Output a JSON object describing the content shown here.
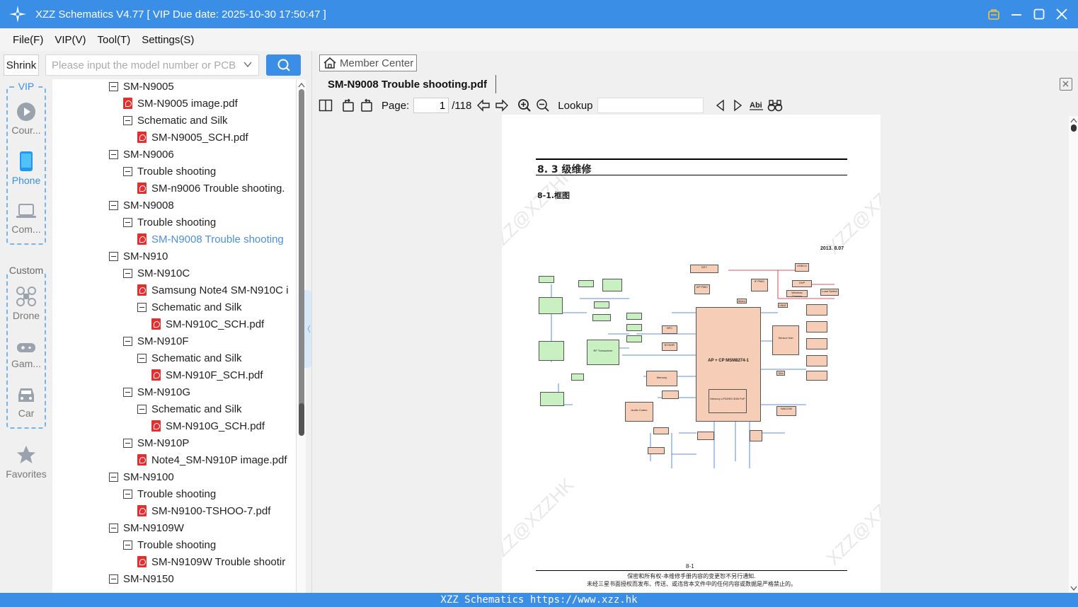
{
  "window": {
    "title": "XZZ Schematics V4.77 [ VIP Due date: 2025-10-30 17:50:47 ]"
  },
  "menu": {
    "items": [
      "File(F)",
      "VIP(V)",
      "Tool(T)",
      "Settings(S)"
    ]
  },
  "search": {
    "shrink_label": "Shrink",
    "placeholder": "Please input the model number or PCB"
  },
  "nav": {
    "vip_label": "VIP",
    "custom_label": "Custom",
    "items": [
      {
        "label": "Cour...",
        "icon": "play-icon"
      },
      {
        "label": "Phone",
        "icon": "phone-icon"
      },
      {
        "label": "Com...",
        "icon": "laptop-icon"
      },
      {
        "label": "Drone",
        "icon": "drone-icon"
      },
      {
        "label": "Gam...",
        "icon": "gamepad-icon"
      },
      {
        "label": "Car",
        "icon": "car-icon"
      },
      {
        "label": "Favorites",
        "icon": "star-icon"
      }
    ]
  },
  "tree": {
    "rows": [
      {
        "text": "SM-N9005",
        "type": "folder"
      },
      {
        "text": "SM-N9005 image.pdf",
        "type": "pdf"
      },
      {
        "text": "Schematic and Silk",
        "type": "folder"
      },
      {
        "text": "SM-N9005_SCH.pdf",
        "type": "pdf"
      },
      {
        "text": "SM-N9006",
        "type": "folder"
      },
      {
        "text": "Trouble shooting",
        "type": "folder"
      },
      {
        "text": "SM-n9006 Trouble shooting.",
        "type": "pdf"
      },
      {
        "text": "SM-N9008",
        "type": "folder"
      },
      {
        "text": "Trouble shooting",
        "type": "folder"
      },
      {
        "text": "SM-N9008 Trouble shooting",
        "type": "pdf"
      },
      {
        "text": "SM-N910",
        "type": "folder"
      },
      {
        "text": "SM-N910C",
        "type": "folder"
      },
      {
        "text": "Samsung Note4 SM-N910C i",
        "type": "pdf"
      },
      {
        "text": "Schematic and Silk",
        "type": "folder"
      },
      {
        "text": "SM-N910C_SCH.pdf",
        "type": "pdf"
      },
      {
        "text": "SM-N910F",
        "type": "folder"
      },
      {
        "text": "Schematic and Silk",
        "type": "folder"
      },
      {
        "text": "SM-N910F_SCH.pdf",
        "type": "pdf"
      },
      {
        "text": "SM-N910G",
        "type": "folder"
      },
      {
        "text": "Schematic and Silk",
        "type": "folder"
      },
      {
        "text": "SM-N910G_SCH.pdf",
        "type": "pdf"
      },
      {
        "text": "SM-N910P",
        "type": "folder"
      },
      {
        "text": "Note4_SM-N910P image.pdf",
        "type": "pdf"
      },
      {
        "text": "SM-N9100",
        "type": "folder"
      },
      {
        "text": "Trouble shooting",
        "type": "folder"
      },
      {
        "text": "SM-N9100-TSHOO-7.pdf",
        "type": "pdf"
      },
      {
        "text": "SM-N9109W",
        "type": "folder"
      },
      {
        "text": "Trouble shooting",
        "type": "folder"
      },
      {
        "text": "SM-N9109W Trouble shootir",
        "type": "pdf"
      },
      {
        "text": "SM-N9150",
        "type": "folder"
      }
    ],
    "selected_index": 9
  },
  "viewer": {
    "member_center": "Member Center",
    "tab_title": "SM-N9008 Trouble shooting.pdf",
    "page_label": "Page:",
    "page_value": "1",
    "page_total": "/118",
    "lookup_label": "Lookup"
  },
  "document": {
    "section": "8. 3 级维修",
    "subsection": "8-1.框图",
    "date": "2013.  8.07",
    "page_number": "8-1",
    "footer1": "保密和所有权-本维修手册内容的变更恕不另行通知.",
    "footer2": "未经三星书面授权而发布、传送、或违背本文件中的任何内容或数据是严格禁止的。",
    "watermark": "XZZ@XZZHK",
    "main_chip": "AP + CP MSM8274-1",
    "blocks": [
      "KEY",
      "AP PMIC",
      "IF PMIC",
      "USB3.0",
      "OVP",
      "Wireless Charger",
      "Load Switch",
      "Motor",
      "VBAT",
      "Sensor Hub",
      "NFC",
      "BT/WIFI",
      "Memory",
      "Audio Codec",
      "RF Transceiver",
      "Memory LPDDR3 3GB PoP",
      "WACOM",
      "SIM"
    ]
  },
  "status": {
    "text": "XZZ Schematics https://www.xzz.hk"
  },
  "colors": {
    "accent": "#3a8ee6",
    "selected_text": "#4a90e2",
    "pdf_icon": "#e03030"
  }
}
